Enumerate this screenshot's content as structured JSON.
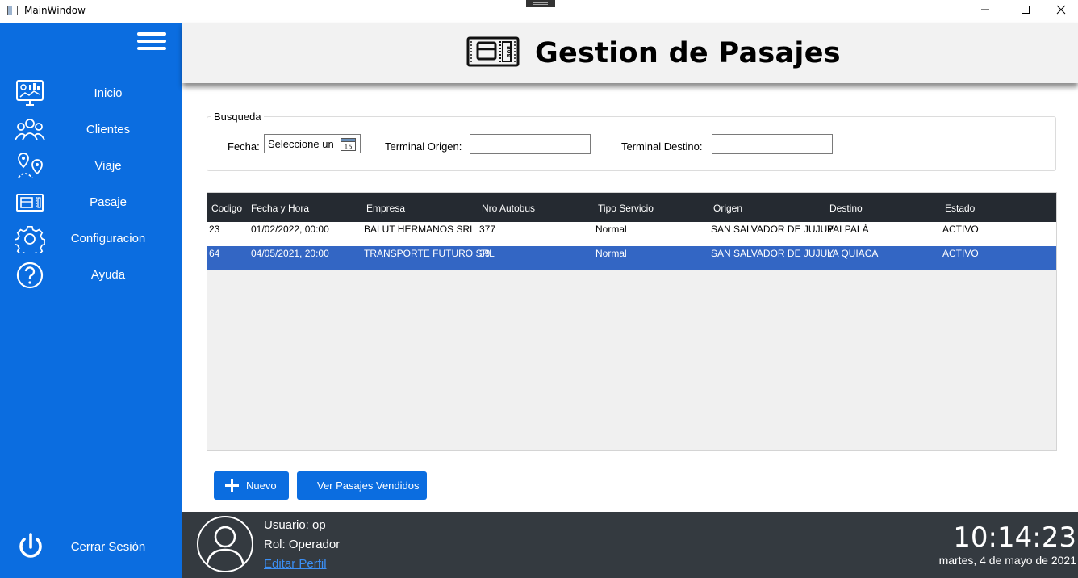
{
  "window": {
    "title": "MainWindow"
  },
  "sidebar": {
    "items": [
      {
        "label": "Inicio",
        "icon": "dashboard-icon"
      },
      {
        "label": "Clientes",
        "icon": "users-icon"
      },
      {
        "label": "Viaje",
        "icon": "route-icon"
      },
      {
        "label": "Pasaje",
        "icon": "ticket-icon"
      },
      {
        "label": "Configuracion",
        "icon": "gear-icon"
      },
      {
        "label": "Ayuda",
        "icon": "help-icon"
      }
    ],
    "logout_label": "Cerrar Sesión"
  },
  "header": {
    "title": "Gestion de Pasajes",
    "icon": "bus-ticket-icon"
  },
  "search": {
    "legend": "Busqueda",
    "fecha_label": "Fecha:",
    "fecha_placeholder": "Seleccione un",
    "calendar_day": "15",
    "origen_label": "Terminal Origen:",
    "origen_value": "",
    "destino_label": "Terminal Destino:",
    "destino_value": ""
  },
  "table": {
    "columns": [
      "Codigo",
      "Fecha y Hora",
      "Empresa",
      "Nro Autobus",
      "Tipo Servicio",
      "Origen",
      "Destino",
      "Estado"
    ],
    "rows": [
      [
        "23",
        "01/02/2022, 00:00",
        "BALUT HERMANOS SRL",
        "377",
        "Normal",
        "SAN SALVADOR DE JUJUY",
        "PALPALÁ",
        "ACTIVO"
      ],
      [
        "64",
        "04/05/2021, 20:00",
        "TRANSPORTE FUTURO SRL",
        "39",
        "Normal",
        "SAN SALVADOR DE JUJUY",
        "LA QUIACA",
        "ACTIVO"
      ]
    ],
    "selected_row": 1
  },
  "actions": {
    "nuevo_label": "Nuevo",
    "vendidos_label": "Ver Pasajes Vendidos"
  },
  "footer": {
    "usuario": "Usuario: op",
    "rol": "Rol: Operador",
    "edit_label": "Editar Perfil",
    "time": "10:14:23",
    "date": "martes, 4 de mayo de 2021"
  },
  "colors": {
    "accent": "#0b6de0",
    "footer": "#343a40",
    "table_header": "#252a31",
    "selected_row": "#3366c4"
  }
}
